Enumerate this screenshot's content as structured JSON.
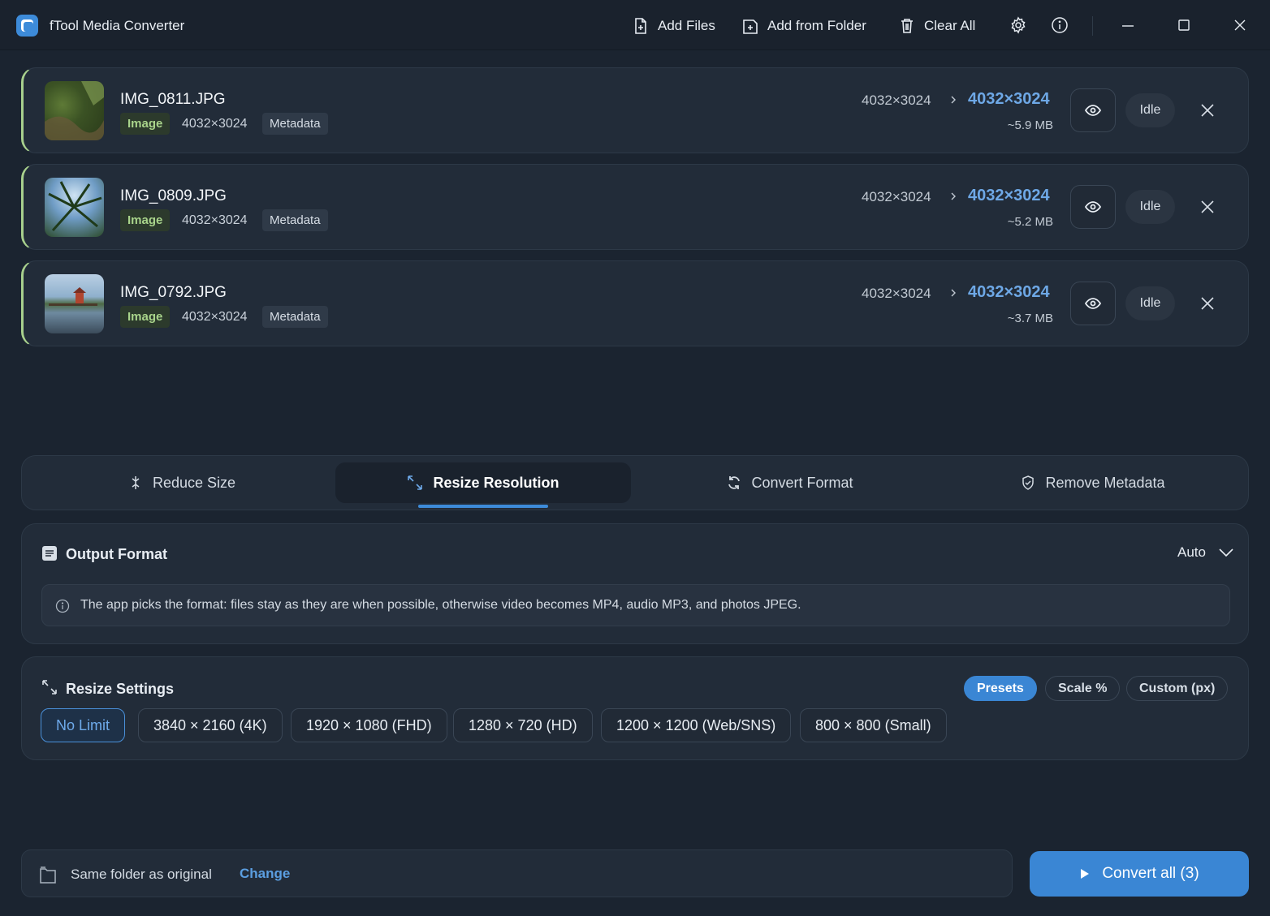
{
  "app": {
    "title": "fTool Media Converter"
  },
  "toolbar": {
    "add_files": "Add Files",
    "add_folder": "Add from Folder",
    "clear_all": "Clear All"
  },
  "files": [
    {
      "name": "IMG_0811.JPG",
      "type": "Image",
      "dims": "4032×3024",
      "meta": "Metadata",
      "orig_res": "4032×3024",
      "new_res": "4032×3024",
      "size": "~5.9 MB",
      "status": "Idle"
    },
    {
      "name": "IMG_0809.JPG",
      "type": "Image",
      "dims": "4032×3024",
      "meta": "Metadata",
      "orig_res": "4032×3024",
      "new_res": "4032×3024",
      "size": "~5.2 MB",
      "status": "Idle"
    },
    {
      "name": "IMG_0792.JPG",
      "type": "Image",
      "dims": "4032×3024",
      "meta": "Metadata",
      "orig_res": "4032×3024",
      "new_res": "4032×3024",
      "size": "~3.7 MB",
      "status": "Idle"
    }
  ],
  "tabs": [
    {
      "label": "Reduce Size"
    },
    {
      "label": "Resize Resolution",
      "active": true
    },
    {
      "label": "Convert Format"
    },
    {
      "label": "Remove Metadata"
    }
  ],
  "output_format": {
    "title": "Output Format",
    "value": "Auto",
    "info": "The app picks the format: files stay as they are when possible, otherwise video becomes MP4, audio MP3, and photos JPEG."
  },
  "resize": {
    "title": "Resize Settings",
    "modes": [
      "Presets",
      "Scale %",
      "Custom (px)"
    ],
    "active_mode": "Presets",
    "presets": [
      "No Limit",
      "3840 × 2160 (4K)",
      "1920 × 1080 (FHD)",
      "1280 × 720 (HD)",
      "1200 × 1200 (Web/SNS)",
      "800 × 800 (Small)"
    ],
    "active_preset": "No Limit"
  },
  "output": {
    "folder": "Same folder as original",
    "change": "Change",
    "convert": "Convert all (3)"
  },
  "colors": {
    "accent": "#3a86d4",
    "highlight_res": "#6ea8e6",
    "image_tag": "#a9d48b",
    "background": "#1b2430"
  }
}
